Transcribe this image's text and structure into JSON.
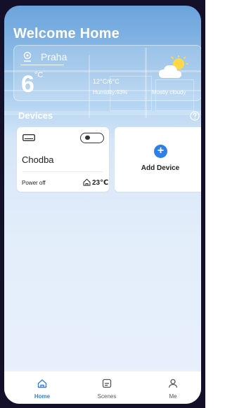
{
  "header": {
    "title": "Welcome Home"
  },
  "weather": {
    "city": "Praha",
    "temperature": "6",
    "unit": "°C",
    "range": "12°C/6°C",
    "humidity": "Humidity:93%",
    "condition": "Mostly cloudy",
    "icon": "partly-cloudy-icon"
  },
  "devices": {
    "section_label": "Devices",
    "items": [
      {
        "name": "Chodba",
        "status": "Power off",
        "temperature": "23℃",
        "icon": "ac-unit-icon",
        "toggle_on": false
      }
    ],
    "add_label": "Add Device"
  },
  "tabbar": {
    "items": [
      {
        "label": "Home",
        "icon": "home-icon",
        "active": true
      },
      {
        "label": "Scenes",
        "icon": "scenes-icon",
        "active": false
      },
      {
        "label": "Me",
        "icon": "profile-icon",
        "active": false
      }
    ]
  },
  "colors": {
    "accent": "#2f7fe8",
    "background_top": "#6aa3dc",
    "background_bottom": "#e6effb"
  }
}
